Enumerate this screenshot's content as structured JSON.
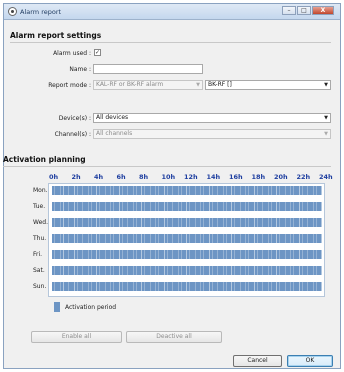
{
  "window": {
    "title": "Alarm report"
  },
  "alarm_settings": {
    "heading": "Alarm report settings",
    "alarm_used_label": "Alarm used :",
    "alarm_used_checked": true,
    "name_label": "Name :",
    "name_value": "",
    "report_mode_label": "Report mode :",
    "report_mode_value": "KAL-RF or BK-RF alarm",
    "report_target_value": "BK-RF []",
    "devices_label": "Device(s) :",
    "devices_value": "All devices",
    "channels_label": "Channel(s) :",
    "channels_value": "All channels"
  },
  "planning": {
    "heading": "Activation planning",
    "hours": [
      "0h",
      "2h",
      "4h",
      "6h",
      "8h",
      "10h",
      "12h",
      "14h",
      "16h",
      "18h",
      "20h",
      "22h",
      "24h"
    ],
    "days": [
      "Mon.",
      "Tue.",
      "Wed.",
      "Thu.",
      "Fri.",
      "Sat.",
      "Sun."
    ],
    "active_color": "#6d95c4",
    "legend_label": "Activation period"
  },
  "buttons": {
    "enable_all": "Enable all",
    "deactive_all": "Deactive all",
    "cancel": "Cancel",
    "ok": "OK"
  },
  "icons": {
    "check_mark": "✓",
    "dropdown_arrow": "▼",
    "minimize": "–",
    "maximize": "□",
    "close": "X"
  }
}
